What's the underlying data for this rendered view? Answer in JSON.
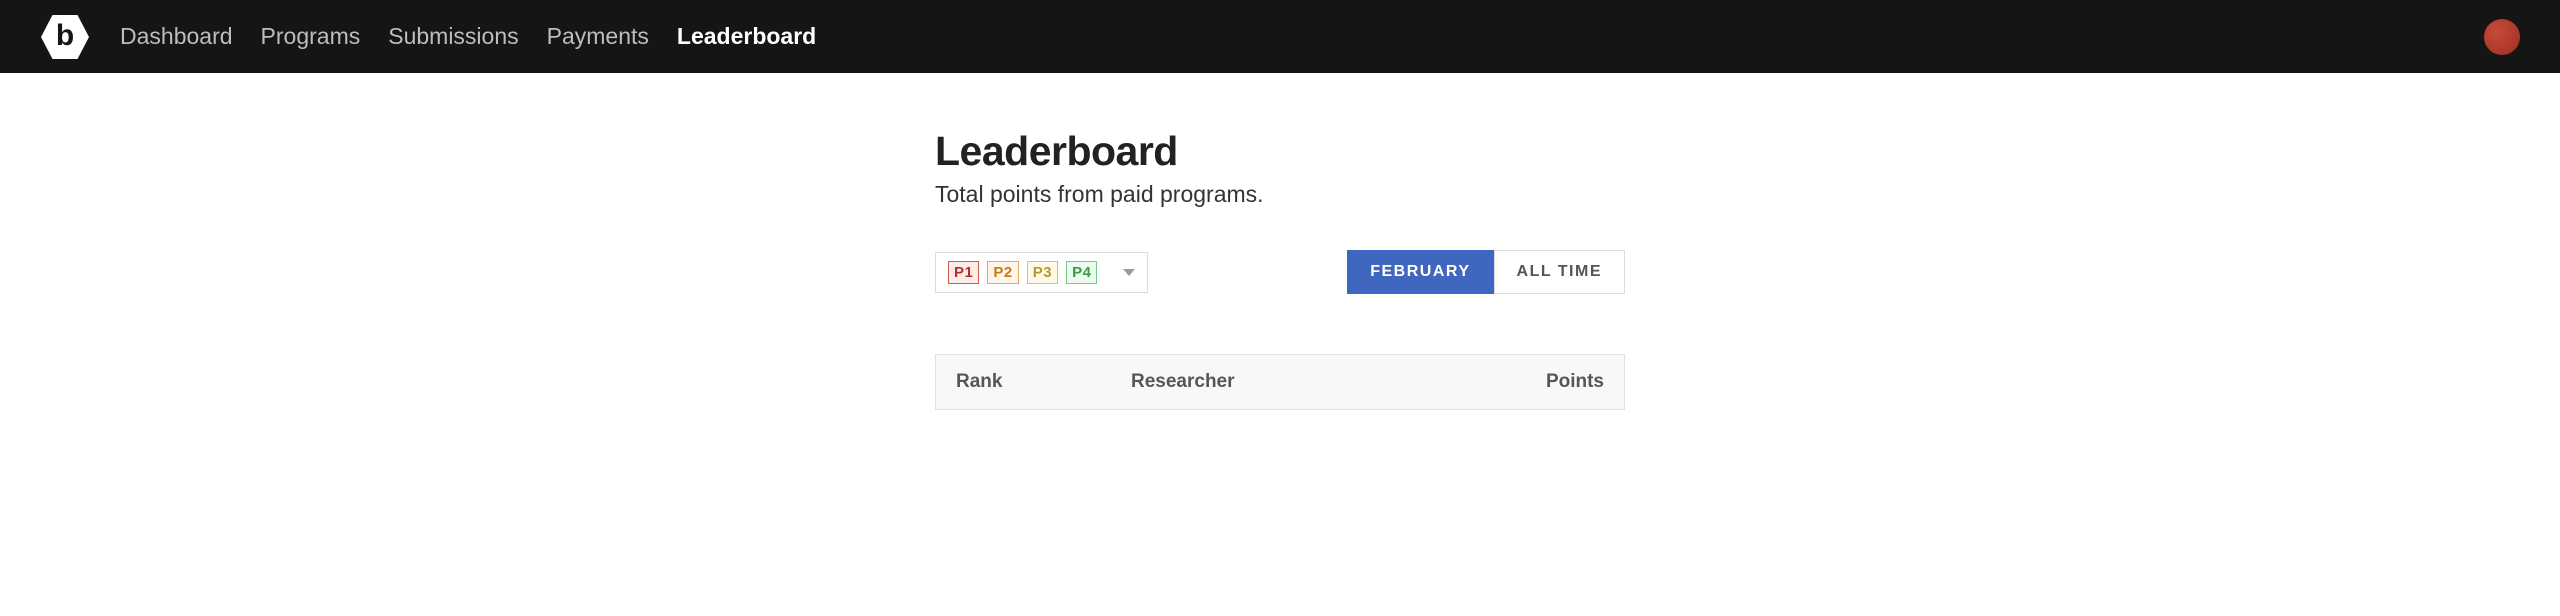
{
  "nav": {
    "items": [
      {
        "label": "Dashboard",
        "active": false
      },
      {
        "label": "Programs",
        "active": false
      },
      {
        "label": "Submissions",
        "active": false
      },
      {
        "label": "Payments",
        "active": false
      },
      {
        "label": "Leaderboard",
        "active": true
      }
    ]
  },
  "page": {
    "title": "Leaderboard",
    "subtitle": "Total points from paid programs."
  },
  "priority_filter": {
    "options": [
      "P1",
      "P2",
      "P3",
      "P4"
    ]
  },
  "time_toggle": {
    "current": "FEBRUARY",
    "alltime": "ALL TIME",
    "active": "current"
  },
  "table": {
    "headers": {
      "rank": "Rank",
      "researcher": "Researcher",
      "points": "Points"
    }
  }
}
